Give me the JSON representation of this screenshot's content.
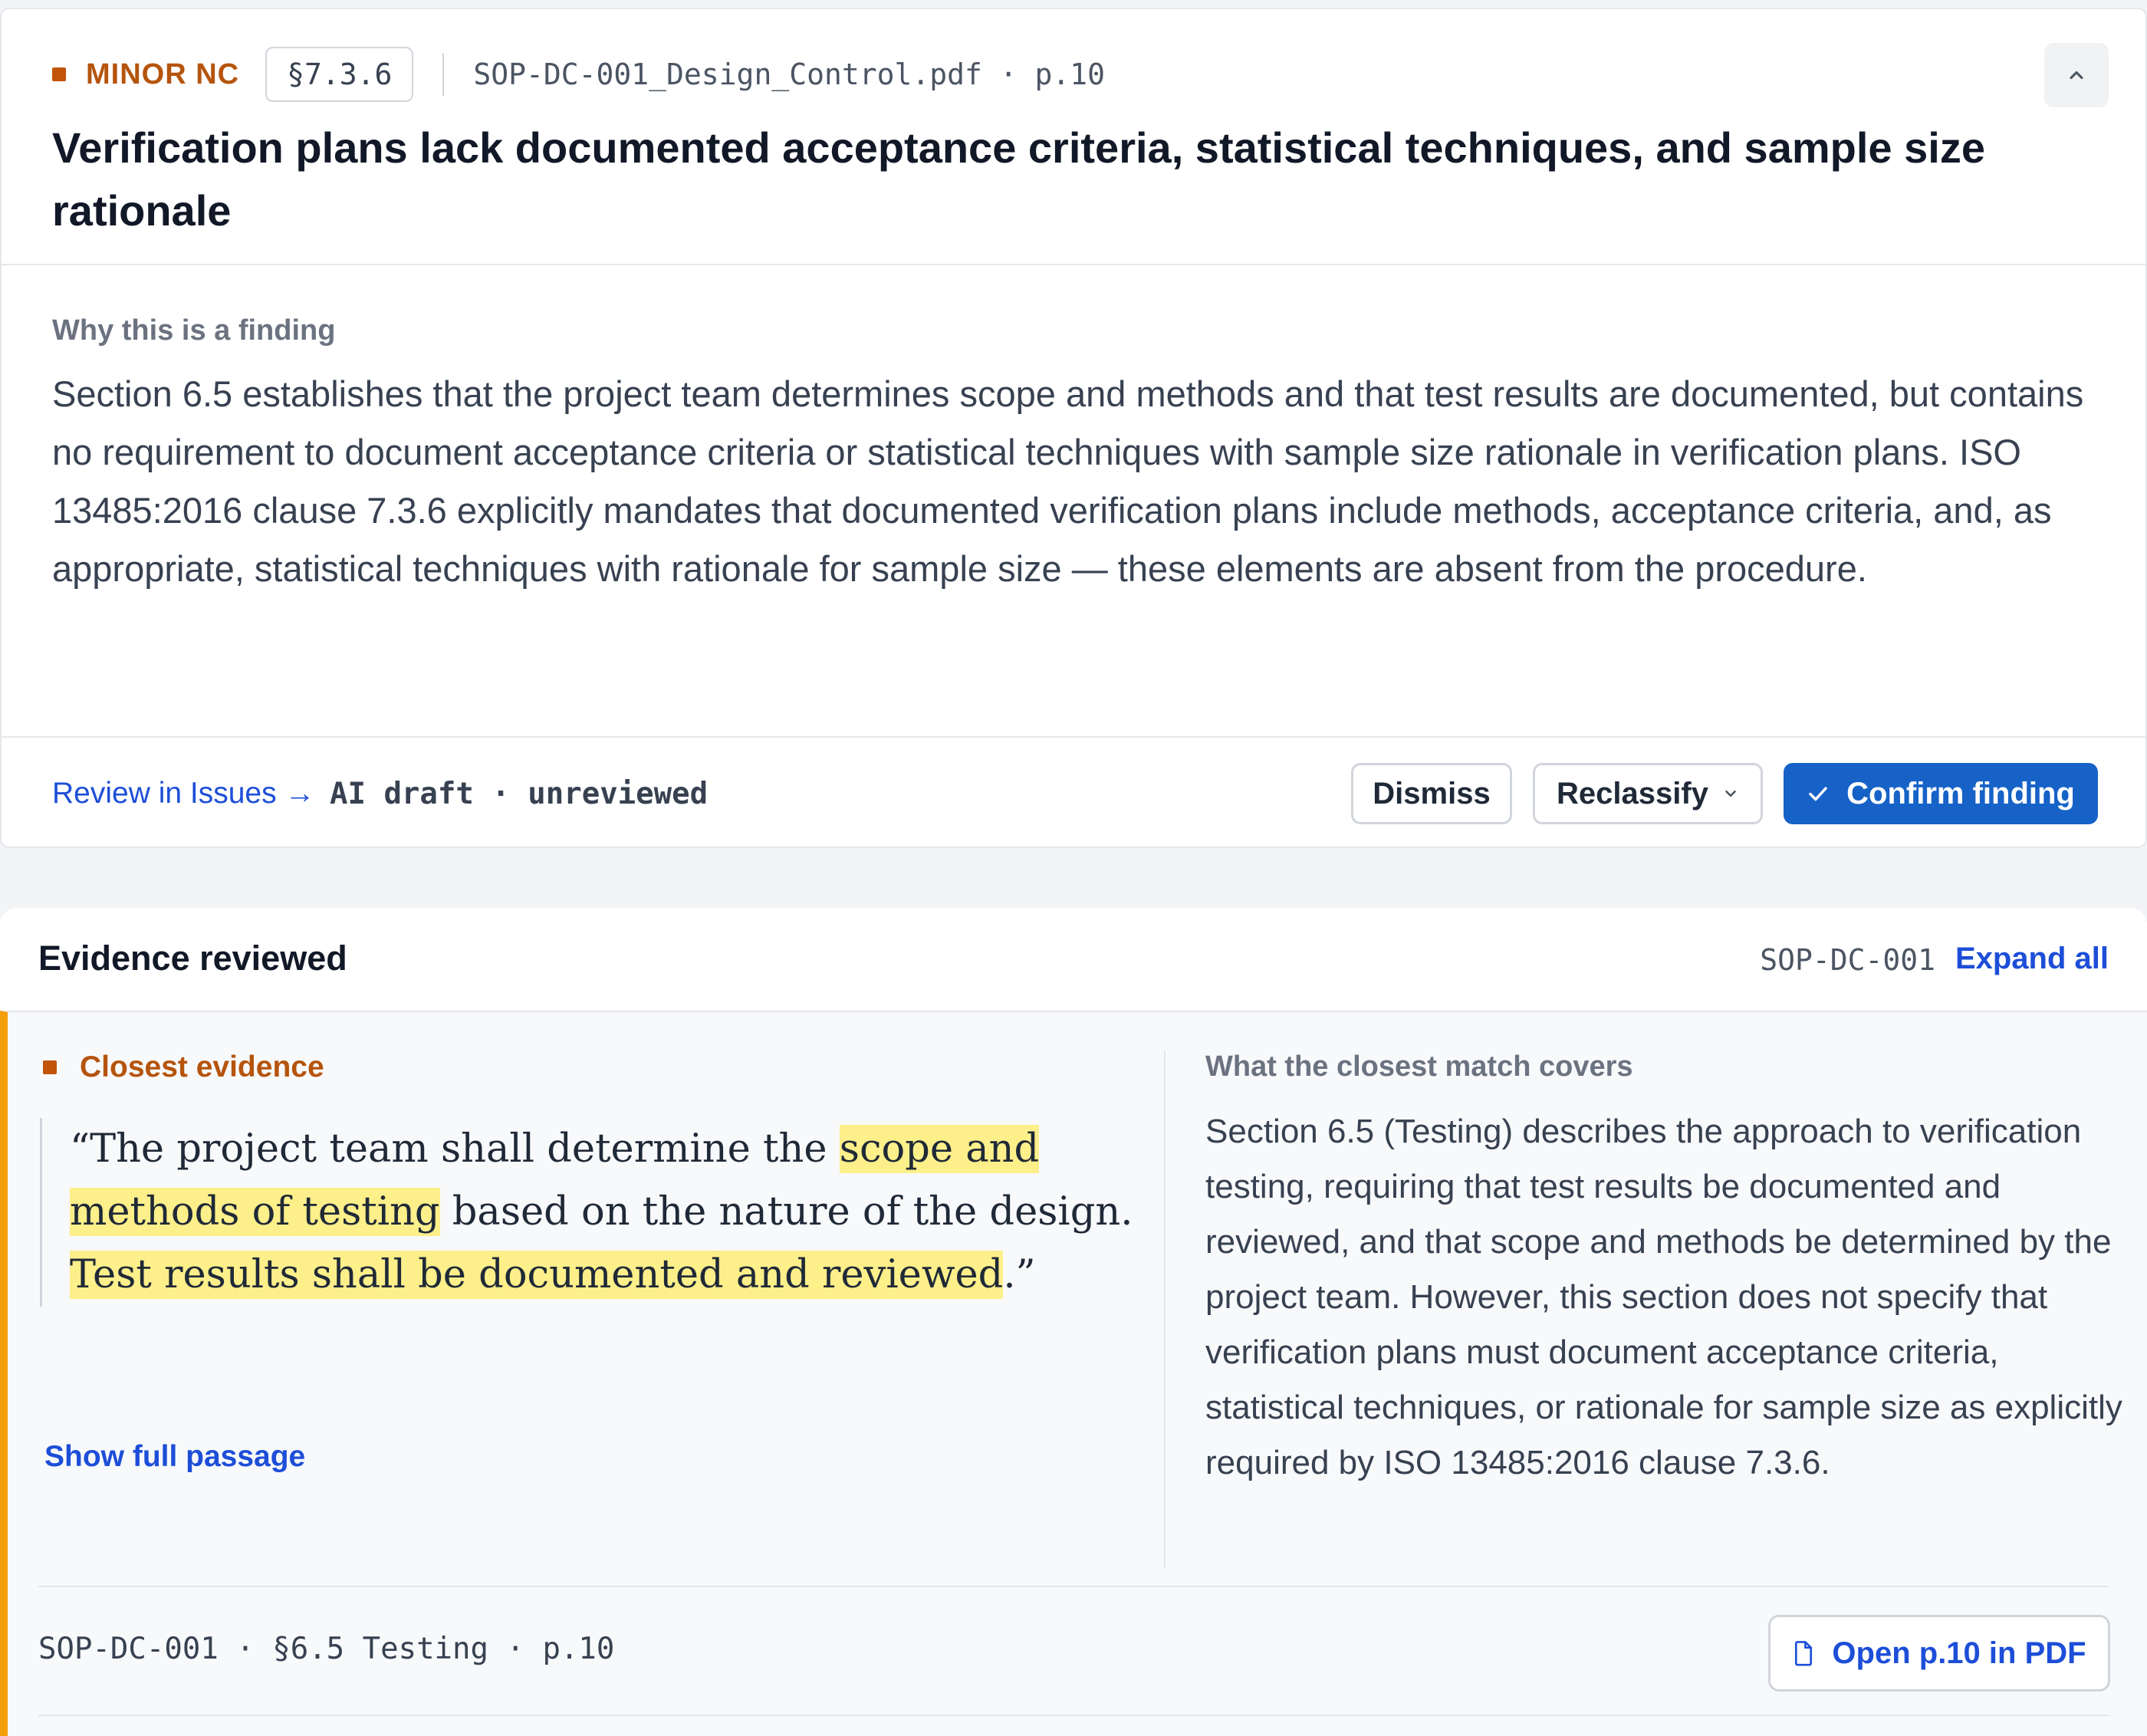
{
  "finding": {
    "severity": "MINOR NC",
    "clause": "§7.3.6",
    "document_ref": "SOP-DC-001_Design_Control.pdf · p.10",
    "title": "Verification plans lack documented acceptance criteria, statistical techniques, and sample size rationale",
    "why_label": "Why this is a finding",
    "why_text": "Section 6.5 establishes that the project team determines scope and methods and that test results are documented, but contains no requirement to document acceptance criteria or statistical techniques with sample size rationale in verification plans. ISO 13485:2016 clause 7.3.6 explicitly mandates that documented verification plans include methods, acceptance criteria, and, as appropriate, statistical techniques with rationale for sample size — these elements are absent from the procedure.",
    "review_link": "Review in Issues →",
    "draft_status": "AI draft · unreviewed",
    "actions": {
      "dismiss": "Dismiss",
      "reclassify": "Reclassify",
      "confirm": "Confirm finding"
    },
    "severity_color": "#b5540c",
    "primary_color": "#1662c7"
  },
  "evidence": {
    "title": "Evidence reviewed",
    "doc_id": "SOP-DC-001",
    "expand_all": "Expand all",
    "closest_label": "Closest evidence",
    "quote": {
      "open": "“The project team shall determine the ",
      "hl1": "scope and methods of testing",
      "mid": " based on the nature of the design. ",
      "hl2": "Test results shall be documented and reviewed",
      "close": ".”"
    },
    "show_full": "Show full passage",
    "covers_label": "What the closest match covers",
    "covers_text": "Section 6.5 (Testing) describes the approach to verification testing, requiring that test results be documented and reviewed, and that scope and methods be determined by the project team. However, this section does not specify that verification plans must document acceptance criteria, statistical techniques, or rationale for sample size as explicitly required by ISO 13485:2016 clause 7.3.6.",
    "source": "SOP-DC-001 · §6.5 Testing · p.10",
    "open_pdf": "Open p.10 in PDF",
    "accent_color": "#f59e0b",
    "highlight_color": "#fdef8a"
  },
  "icons": [
    "chevron-up-icon",
    "chevron-down-icon",
    "check-icon",
    "file-icon"
  ]
}
